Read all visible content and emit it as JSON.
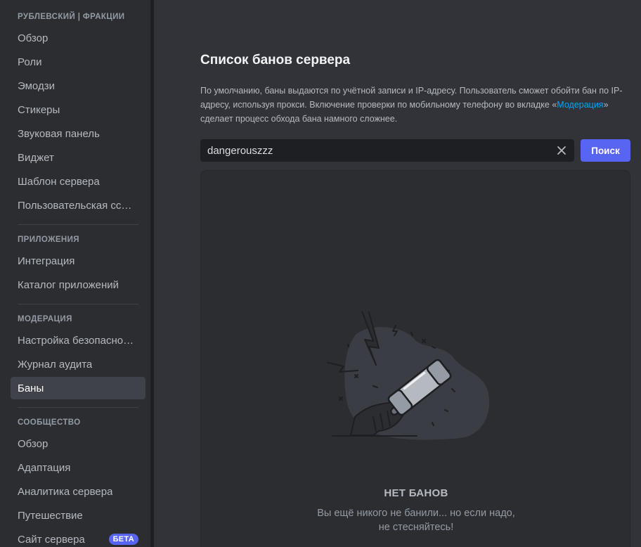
{
  "sidebar": {
    "server_header": "РУБЛЕВСКИЙ | ФРАКЦИИ",
    "server_items": [
      {
        "label": "Обзор"
      },
      {
        "label": "Роли"
      },
      {
        "label": "Эмодзи"
      },
      {
        "label": "Стикеры"
      },
      {
        "label": "Звуковая панель"
      },
      {
        "label": "Виджет"
      },
      {
        "label": "Шаблон сервера"
      },
      {
        "label": "Пользовательская ссылка"
      }
    ],
    "apps_header": "ПРИЛОЖЕНИЯ",
    "apps_items": [
      {
        "label": "Интеграция"
      },
      {
        "label": "Каталог приложений"
      }
    ],
    "moderation_header": "МОДЕРАЦИЯ",
    "moderation_items": [
      {
        "label": "Настройка безопасности"
      },
      {
        "label": "Журнал аудита"
      },
      {
        "label": "Баны"
      }
    ],
    "community_header": "СООБЩЕСТВО",
    "community_items": [
      {
        "label": "Обзор"
      },
      {
        "label": "Адаптация"
      },
      {
        "label": "Аналитика сервера"
      },
      {
        "label": "Путешествие"
      },
      {
        "label": "Сайт сервера",
        "badge": "БЕТА"
      }
    ]
  },
  "main": {
    "title": "Список банов сервера",
    "description_before": "По умолчанию, баны выдаются по учётной записи и IP-адресу. Пользователь сможет обойти бан по IP-адресу, используя прокси. Включение проверки по мобильному телефону во вкладке «",
    "description_link": "Модерация",
    "description_after": "» сделает процесс обхода бана намного сложнее.",
    "search": {
      "value": "dangerouszzz",
      "button_label": "Поиск"
    },
    "empty_state": {
      "title": "НЕТ БАНОВ",
      "line1": "Вы ещё никого не банили... но если надо,",
      "line2": "не стесняйтесь!"
    }
  },
  "colors": {
    "accent": "#5865f2",
    "link": "#00a8fc",
    "sidebar_bg": "#2b2d31",
    "main_bg": "#313338",
    "active_item_bg": "#404249"
  },
  "icons": {
    "clear": "close-icon",
    "illustration": "ban-hammer-illustration"
  }
}
